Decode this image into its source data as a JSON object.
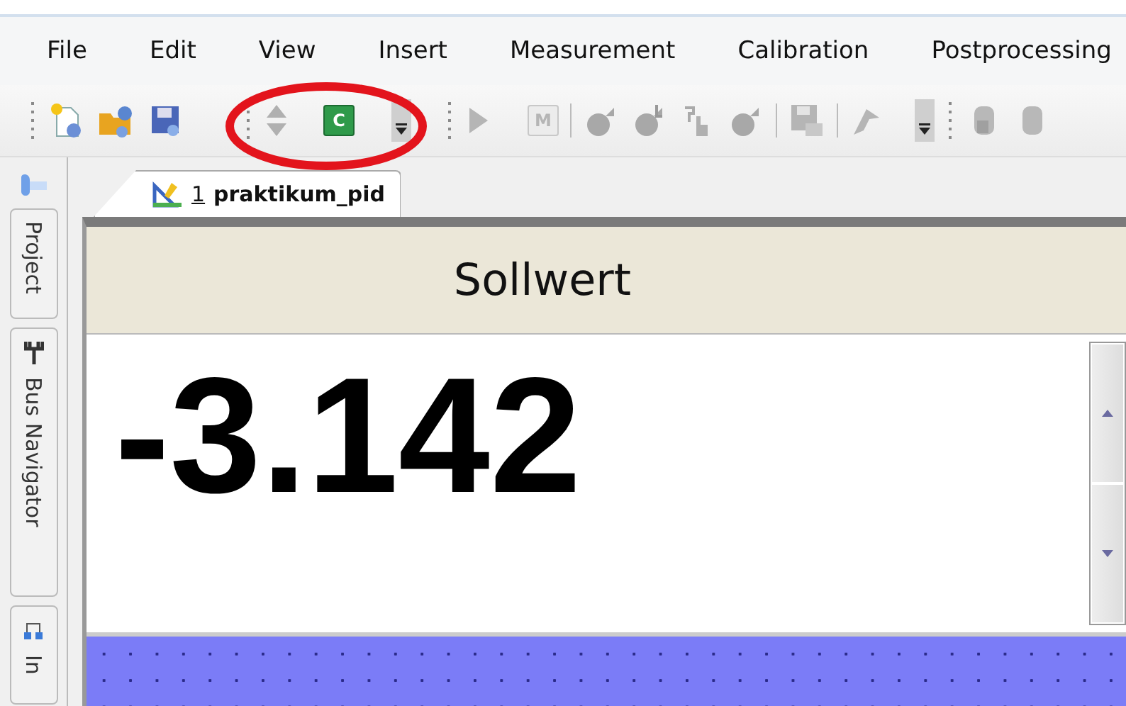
{
  "menu": [
    "File",
    "Edit",
    "View",
    "Insert",
    "Measurement",
    "Calibration",
    "Postprocessing"
  ],
  "letter_buttons": [
    {
      "text": "C",
      "disabled": false
    },
    {
      "text": "M",
      "disabled": true
    }
  ],
  "side_tabs": [
    "Project",
    "Bus Navigator",
    "In"
  ],
  "document_tab": {
    "number": "1",
    "name": "praktikum_pid",
    "selected": true
  },
  "panel": {
    "title": "Sollwert",
    "value": "-3.142"
  }
}
